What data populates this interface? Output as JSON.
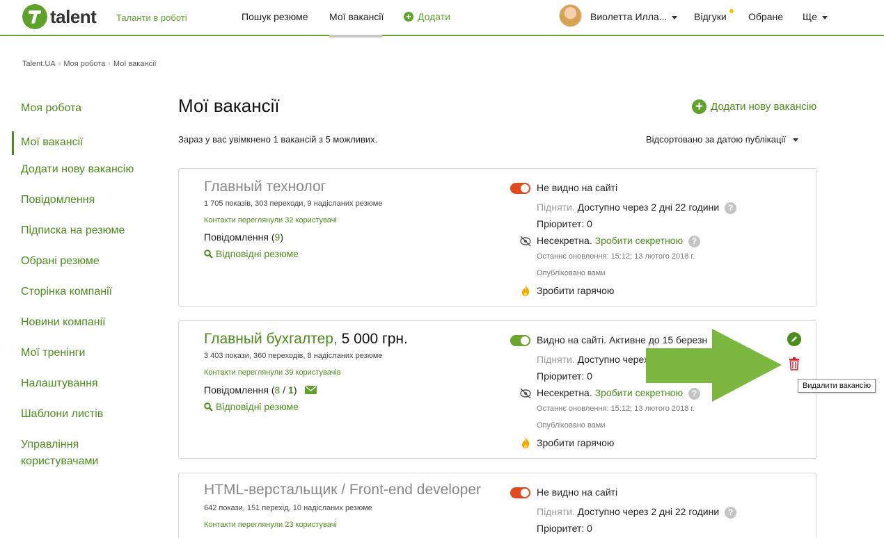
{
  "header": {
    "logo_text": "talent",
    "slogan": "Таланти в роботі",
    "nav": {
      "search": "Пошук резюме",
      "vacancies": "Мої вакансії",
      "add": "Додати"
    },
    "user_name": "Виолетта Илла...",
    "reviews": "Відгуки",
    "favorites": "Обране",
    "more": "Ще"
  },
  "breadcrumb": [
    "Talent.UA",
    "Моя робота",
    "Мої вакансії"
  ],
  "sidebar": {
    "items": [
      "Моя робота",
      "Мої вакансії",
      "Додати нову вакансію",
      "Повідомлення",
      "Підписка на резюме",
      "Обрані резюме",
      "Сторінка компанії",
      "Новини компанії",
      "Мої тренінги",
      "Налаштування",
      "Шаблони листів",
      "Управління користувачами"
    ]
  },
  "main": {
    "title": "Мої вакансії",
    "add_label": "Додати нову вакансію",
    "summary": "Зараз у вас увімкнено 1 вакансій з 5 можливих.",
    "sort_label": "Відсортовано за датою публікації"
  },
  "vacancies": [
    {
      "title": "Главный технолог",
      "stats": "1 705 показів, 303 переходи, 9 надісланих резюме",
      "viewed": "Контакти переглянули 32 користувачі",
      "messages_label": "Повідомлення",
      "messages_count": "9",
      "resumes": "Відповідні резюме",
      "visibility": "Не видно на сайті",
      "raise_label": "Підняти.",
      "raise_info": "Доступно через 2 дні 22 години",
      "priority": "Пріоритет: 0",
      "secret_state": "Несекретна.",
      "secret_action": "Зробити секретною",
      "updated": "Останнє оновлення: 15:12; 13 лютого 2018 г.",
      "published": "Опубліковано вами",
      "hot": "Зробити гарячою"
    },
    {
      "title": "Главный бухгалтер,",
      "salary": "5 000 грн.",
      "stats": "3 403 покази, 360 переходів, 8 надісланих резюме",
      "viewed": "Контакти переглянули 39 користувачів",
      "messages_label": "Повідомлення",
      "messages_count": "8",
      "messages_new": "1",
      "resumes": "Відповідні резюме",
      "visibility": "Видно на сайті. Активне до 15 березн",
      "raise_label": "Підняти.",
      "raise_info": "Доступно черех",
      "priority": "Пріоритет: 0",
      "secret_state": "Несекретна.",
      "secret_action": "Зробити секретною",
      "updated": "Останнє оновлення: 15:12; 13 лютого 2018 г.",
      "published": "Опубліковано вами",
      "hot": "Зробити гарячою"
    },
    {
      "title": "HTML-верстальщик / Front-end developer",
      "stats": "642 покази, 151 перехід, 10 надісланих резюме",
      "viewed": "Контакти переглянули 23 користувачі",
      "visibility": "Не видно на сайті",
      "raise_label": "Підняти.",
      "raise_info": "Доступно через 2 дні 22 години",
      "priority": "Пріоритет: 0"
    }
  ],
  "tooltip": "Видалити вакансію",
  "colors": {
    "accent": "#5fa22a",
    "link": "#4c8c1c",
    "off": "#e24a1d",
    "arrow": "#7cb73f"
  }
}
